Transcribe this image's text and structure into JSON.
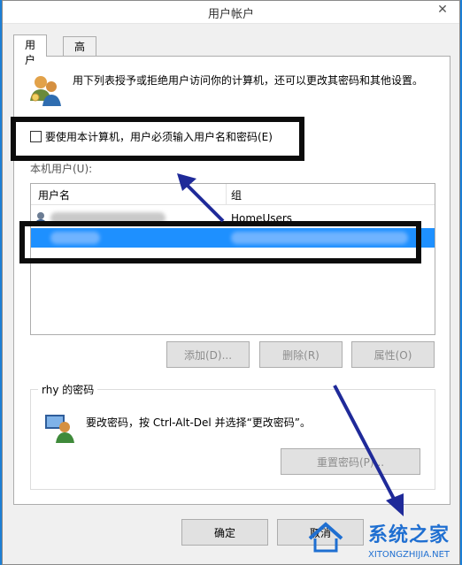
{
  "window": {
    "title": "用户帐户"
  },
  "tabs": [
    {
      "label": "用户"
    },
    {
      "label": "高级"
    }
  ],
  "intro": {
    "text": "用下列表授予或拒绝用户访问你的计算机，还可以更改其密码和其他设置。"
  },
  "checkbox": {
    "label": "要使用本计算机，用户必须输入用户名和密码(E)",
    "checked": false
  },
  "users": {
    "label": "本机用户(U):",
    "columns": [
      "用户名",
      "组"
    ],
    "rows": [
      {
        "group": "HomeUsers"
      }
    ]
  },
  "buttons": {
    "add": "添加(D)...",
    "delete": "删除(R)",
    "properties": "属性(O)",
    "ok": "确定",
    "cancel": "取消"
  },
  "password": {
    "title": "rhy 的密码",
    "text": "要改密码，按 Ctrl-Alt-Del 并选择“更改密码”。",
    "reset_button": "重置密码(P)..."
  },
  "watermark": {
    "cn": "系统之家",
    "en": "XITONGZHIJIA.NET"
  },
  "colors": {
    "selection": "#1e90ff",
    "arrow": "#1f2a99",
    "desktop": "#1c7fd6"
  }
}
